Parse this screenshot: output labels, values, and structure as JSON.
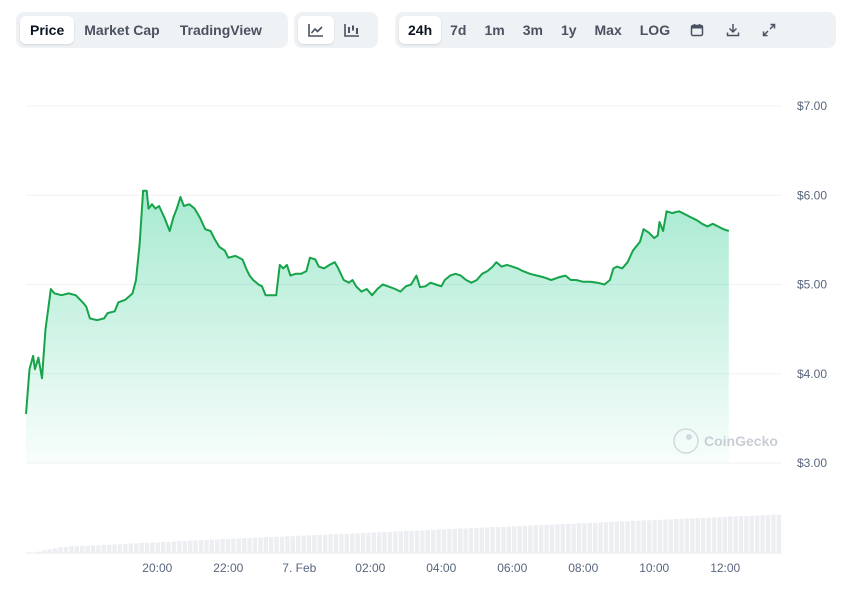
{
  "toolbar": {
    "view_tabs": [
      "Price",
      "Market Cap",
      "TradingView"
    ],
    "active_view": "Price",
    "chart_style_icons": [
      "line-chart-icon",
      "candlestick-icon"
    ],
    "range_tabs": [
      "24h",
      "7d",
      "1m",
      "3m",
      "1y",
      "Max",
      "LOG"
    ],
    "active_range": "24h",
    "action_icons": [
      "calendar-icon",
      "download-icon",
      "expand-icon"
    ]
  },
  "watermark": "CoinGecko",
  "colors": {
    "line": "#16c784",
    "line_dark": "#16a34a",
    "fill": "#16c784",
    "volume": "#eceef2",
    "grid": "#eff2f5"
  },
  "chart_data": {
    "type": "area",
    "title": "",
    "xlabel": "",
    "ylabel": "",
    "y_tick_labels": [
      "$3.00",
      "$4.00",
      "$5.00",
      "$6.00",
      "$7.00"
    ],
    "y_ticks": [
      3,
      4,
      5,
      6,
      7
    ],
    "ylim": [
      3,
      7
    ],
    "x_tick_labels": [
      "20:00",
      "22:00",
      "7. Feb",
      "02:00",
      "04:00",
      "06:00",
      "08:00",
      "10:00",
      "12:00"
    ],
    "x_ticks": [
      20,
      22,
      24,
      26,
      28,
      30,
      32,
      34,
      36
    ],
    "xlim": [
      16.3,
      37.6
    ],
    "grid": true,
    "series": [
      {
        "values": [
          [
            16.3,
            3.55
          ],
          [
            16.4,
            4.05
          ],
          [
            16.5,
            4.2
          ],
          [
            16.55,
            4.05
          ],
          [
            16.65,
            4.18
          ],
          [
            16.75,
            3.95
          ],
          [
            16.85,
            4.5
          ],
          [
            16.95,
            4.8
          ],
          [
            17.0,
            4.95
          ],
          [
            17.1,
            4.9
          ],
          [
            17.3,
            4.88
          ],
          [
            17.5,
            4.9
          ],
          [
            17.7,
            4.88
          ],
          [
            17.9,
            4.8
          ],
          [
            18.0,
            4.75
          ],
          [
            18.1,
            4.62
          ],
          [
            18.3,
            4.6
          ],
          [
            18.5,
            4.62
          ],
          [
            18.6,
            4.68
          ],
          [
            18.8,
            4.7
          ],
          [
            18.9,
            4.8
          ],
          [
            19.1,
            4.83
          ],
          [
            19.3,
            4.9
          ],
          [
            19.4,
            5.05
          ],
          [
            19.5,
            5.45
          ],
          [
            19.6,
            6.05
          ],
          [
            19.7,
            6.05
          ],
          [
            19.75,
            5.85
          ],
          [
            19.85,
            5.9
          ],
          [
            19.95,
            5.85
          ],
          [
            20.05,
            5.88
          ],
          [
            20.2,
            5.75
          ],
          [
            20.35,
            5.6
          ],
          [
            20.45,
            5.75
          ],
          [
            20.55,
            5.85
          ],
          [
            20.65,
            5.98
          ],
          [
            20.75,
            5.88
          ],
          [
            20.9,
            5.9
          ],
          [
            21.05,
            5.85
          ],
          [
            21.2,
            5.75
          ],
          [
            21.35,
            5.62
          ],
          [
            21.5,
            5.6
          ],
          [
            21.6,
            5.52
          ],
          [
            21.75,
            5.42
          ],
          [
            21.9,
            5.38
          ],
          [
            22.0,
            5.3
          ],
          [
            22.2,
            5.32
          ],
          [
            22.4,
            5.28
          ],
          [
            22.5,
            5.18
          ],
          [
            22.6,
            5.1
          ],
          [
            22.7,
            5.05
          ],
          [
            22.85,
            5.0
          ],
          [
            22.95,
            4.98
          ],
          [
            23.05,
            4.88
          ],
          [
            23.25,
            4.88
          ],
          [
            23.35,
            4.88
          ],
          [
            23.45,
            5.22
          ],
          [
            23.55,
            5.18
          ],
          [
            23.65,
            5.22
          ],
          [
            23.75,
            5.1
          ],
          [
            23.9,
            5.12
          ],
          [
            24.05,
            5.12
          ],
          [
            24.2,
            5.15
          ],
          [
            24.3,
            5.3
          ],
          [
            24.45,
            5.28
          ],
          [
            24.55,
            5.2
          ],
          [
            24.7,
            5.18
          ],
          [
            24.85,
            5.22
          ],
          [
            25.0,
            5.25
          ],
          [
            25.1,
            5.18
          ],
          [
            25.25,
            5.05
          ],
          [
            25.4,
            5.02
          ],
          [
            25.5,
            5.05
          ],
          [
            25.6,
            4.98
          ],
          [
            25.75,
            4.92
          ],
          [
            25.9,
            4.95
          ],
          [
            26.05,
            4.88
          ],
          [
            26.2,
            4.95
          ],
          [
            26.35,
            5.0
          ],
          [
            26.5,
            4.98
          ],
          [
            26.7,
            4.95
          ],
          [
            26.85,
            4.92
          ],
          [
            27.0,
            4.98
          ],
          [
            27.15,
            5.0
          ],
          [
            27.3,
            5.1
          ],
          [
            27.4,
            4.97
          ],
          [
            27.55,
            4.98
          ],
          [
            27.7,
            5.02
          ],
          [
            27.85,
            5.0
          ],
          [
            28.0,
            4.98
          ],
          [
            28.1,
            5.05
          ],
          [
            28.25,
            5.1
          ],
          [
            28.4,
            5.12
          ],
          [
            28.55,
            5.1
          ],
          [
            28.7,
            5.05
          ],
          [
            28.85,
            5.02
          ],
          [
            29.0,
            5.05
          ],
          [
            29.15,
            5.12
          ],
          [
            29.3,
            5.15
          ],
          [
            29.45,
            5.2
          ],
          [
            29.55,
            5.25
          ],
          [
            29.7,
            5.2
          ],
          [
            29.85,
            5.22
          ],
          [
            30.0,
            5.2
          ],
          [
            30.15,
            5.18
          ],
          [
            30.3,
            5.15
          ],
          [
            30.5,
            5.12
          ],
          [
            30.7,
            5.1
          ],
          [
            30.9,
            5.08
          ],
          [
            31.1,
            5.05
          ],
          [
            31.3,
            5.08
          ],
          [
            31.5,
            5.1
          ],
          [
            31.65,
            5.05
          ],
          [
            31.8,
            5.05
          ],
          [
            32.0,
            5.03
          ],
          [
            32.2,
            5.03
          ],
          [
            32.4,
            5.02
          ],
          [
            32.6,
            5.0
          ],
          [
            32.75,
            5.05
          ],
          [
            32.85,
            5.18
          ],
          [
            32.95,
            5.2
          ],
          [
            33.1,
            5.18
          ],
          [
            33.25,
            5.25
          ],
          [
            33.4,
            5.38
          ],
          [
            33.6,
            5.48
          ],
          [
            33.7,
            5.62
          ],
          [
            33.85,
            5.58
          ],
          [
            34.0,
            5.52
          ],
          [
            34.1,
            5.55
          ],
          [
            34.15,
            5.7
          ],
          [
            34.25,
            5.6
          ],
          [
            34.35,
            5.82
          ],
          [
            34.5,
            5.8
          ],
          [
            34.7,
            5.82
          ],
          [
            34.9,
            5.78
          ],
          [
            35.05,
            5.75
          ],
          [
            35.2,
            5.72
          ],
          [
            35.35,
            5.68
          ],
          [
            35.5,
            5.65
          ],
          [
            35.65,
            5.68
          ],
          [
            35.8,
            5.65
          ],
          [
            35.95,
            5.62
          ],
          [
            36.1,
            5.6
          ]
        ]
      }
    ],
    "volume": [
      0.0,
      0.01,
      0.03,
      0.06,
      0.08,
      0.1,
      0.12,
      0.13,
      0.14,
      0.14,
      0.15,
      0.15,
      0.16,
      0.16,
      0.17,
      0.17,
      0.18,
      0.18,
      0.19,
      0.2,
      0.2,
      0.21,
      0.21,
      0.22,
      0.22,
      0.23,
      0.23,
      0.24,
      0.25,
      0.25,
      0.26,
      0.26,
      0.27,
      0.27,
      0.28,
      0.28,
      0.29,
      0.29,
      0.3,
      0.3,
      0.31,
      0.31,
      0.32,
      0.32,
      0.33,
      0.33,
      0.34,
      0.34,
      0.35,
      0.35,
      0.36,
      0.36,
      0.37,
      0.37,
      0.38,
      0.38,
      0.39,
      0.39,
      0.4,
      0.4,
      0.41,
      0.41,
      0.42,
      0.42,
      0.43,
      0.43,
      0.44,
      0.44,
      0.45,
      0.45,
      0.46,
      0.46,
      0.47,
      0.47,
      0.48,
      0.48,
      0.49,
      0.49,
      0.5,
      0.5,
      0.51,
      0.51,
      0.52,
      0.52,
      0.53,
      0.53,
      0.54,
      0.54,
      0.55,
      0.55,
      0.56,
      0.56,
      0.57,
      0.57,
      0.58,
      0.58,
      0.59,
      0.59,
      0.6,
      0.6,
      0.61,
      0.61,
      0.62,
      0.62,
      0.63,
      0.63,
      0.64,
      0.64,
      0.65,
      0.65,
      0.66,
      0.66,
      0.67,
      0.67,
      0.68,
      0.68,
      0.69,
      0.69,
      0.7,
      0.7,
      0.71,
      0.71,
      0.72,
      0.72,
      0.73,
      0.73,
      0.74,
      0.74,
      0.75,
      0.75,
      0.76,
      0.76,
      0.77,
      0.77,
      0.78,
      0.78,
      0.79,
      0.79,
      0.8,
      0.8
    ]
  }
}
